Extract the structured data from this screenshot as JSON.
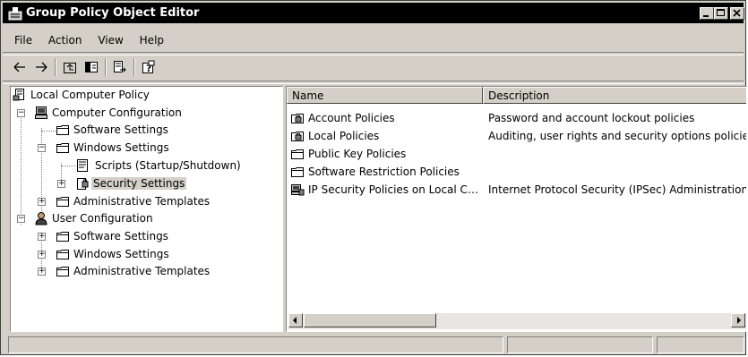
{
  "window": {
    "title": "Group Policy Object Editor"
  },
  "menubar": {
    "items": [
      "File",
      "Action",
      "View",
      "Help"
    ]
  },
  "toolbar": {
    "buttons": [
      "back-icon",
      "forward-icon",
      "up-one-level-icon",
      "show-hide-tree-icon",
      "export-list-icon",
      "help-icon"
    ]
  },
  "tree": {
    "items": [
      {
        "label": "Local Computer Policy",
        "icon": "policy-icon"
      },
      {
        "label": "Computer Configuration",
        "icon": "computer-icon"
      },
      {
        "label": "Software Settings",
        "icon": "folder-icon"
      },
      {
        "label": "Windows Settings",
        "icon": "folder-icon"
      },
      {
        "label": "Scripts (Startup/Shutdown)",
        "icon": "script-icon"
      },
      {
        "label": "Security Settings",
        "icon": "security-icon",
        "selected": true
      },
      {
        "label": "Administrative Templates",
        "icon": "folder-icon"
      },
      {
        "label": "User Configuration",
        "icon": "user-icon"
      },
      {
        "label": "Software Settings",
        "icon": "folder-icon"
      },
      {
        "label": "Windows Settings",
        "icon": "folder-icon"
      },
      {
        "label": "Administrative Templates",
        "icon": "folder-icon"
      }
    ]
  },
  "list": {
    "columns": [
      "Name",
      "Description"
    ],
    "rows": [
      {
        "name": "Account Policies",
        "description": "Password and account lockout policies",
        "icon": "locked-folder-icon"
      },
      {
        "name": "Local Policies",
        "description": "Auditing, user rights and security options policies",
        "icon": "locked-folder-icon"
      },
      {
        "name": "Public Key Policies",
        "description": "",
        "icon": "folder-icon"
      },
      {
        "name": "Software Restriction Policies",
        "description": "",
        "icon": "folder-icon"
      },
      {
        "name": "IP Security Policies on Local C…",
        "description": "Internet Protocol Security (IPSec) Administration",
        "icon": "ip-security-icon"
      }
    ]
  },
  "statusbar": {
    "text": ""
  }
}
